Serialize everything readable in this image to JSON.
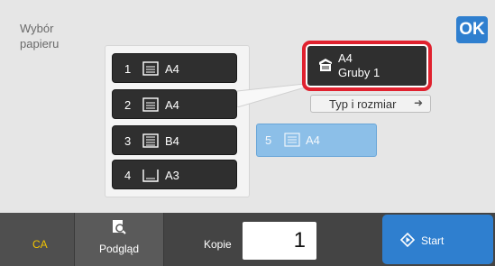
{
  "header": {
    "title": "Wybór papieru",
    "ok_label": "OK"
  },
  "trays": [
    {
      "number": "1",
      "size": "A4"
    },
    {
      "number": "2",
      "size": "A4"
    },
    {
      "number": "3",
      "size": "B4"
    },
    {
      "number": "4",
      "size": "A3"
    }
  ],
  "bypass_tray": {
    "number": "5",
    "size": "A4"
  },
  "selected": {
    "size": "A4",
    "type": "Gruby 1"
  },
  "type_size_button": {
    "label": "Typ i rozmiar"
  },
  "bottom": {
    "ca_label": "CA",
    "preview_label": "Podgląd",
    "copies_label": "Kopie",
    "copies_value": "1",
    "start_label": "Start"
  },
  "colors": {
    "accent_blue": "#2f7fcf",
    "highlight_red": "#e0212e",
    "ca_yellow": "#f2c400"
  }
}
